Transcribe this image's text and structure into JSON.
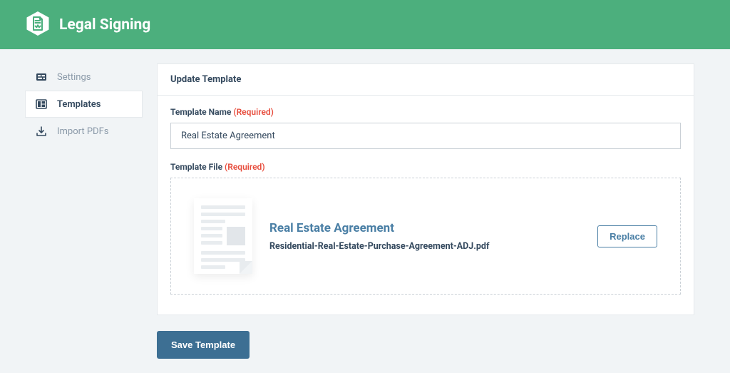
{
  "app": {
    "title": "Legal Signing"
  },
  "sidebar": {
    "items": [
      {
        "label": "Settings"
      },
      {
        "label": "Templates"
      },
      {
        "label": "Import PDFs"
      }
    ],
    "active_index": 1
  },
  "panel": {
    "title": "Update Template",
    "name_label": "Template Name",
    "file_label": "Template File",
    "required_text": "(Required)",
    "name_value": "Real Estate Agreement",
    "file": {
      "title": "Real Estate Agreement",
      "filename": "Residential-Real-Estate-Purchase-Agreement-ADJ.pdf"
    },
    "replace_label": "Replace",
    "save_label": "Save Template"
  }
}
